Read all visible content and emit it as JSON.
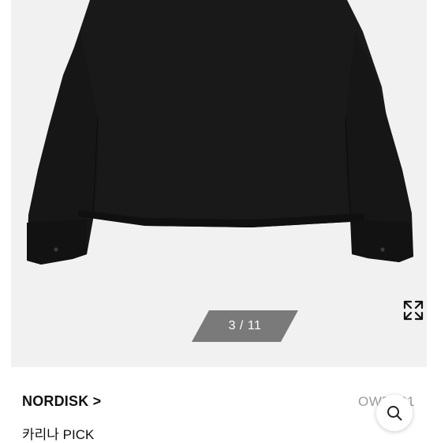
{
  "gallery": {
    "counter": "3 / 11",
    "background_color": "#f1f1f1",
    "product_color": "#191919"
  },
  "product": {
    "brand_link": "NORDISK >",
    "code": "OWP261",
    "subtitle": "카리나 PICK"
  },
  "icons": {
    "expand": "expand-arrows-icon",
    "search": "search-icon"
  }
}
